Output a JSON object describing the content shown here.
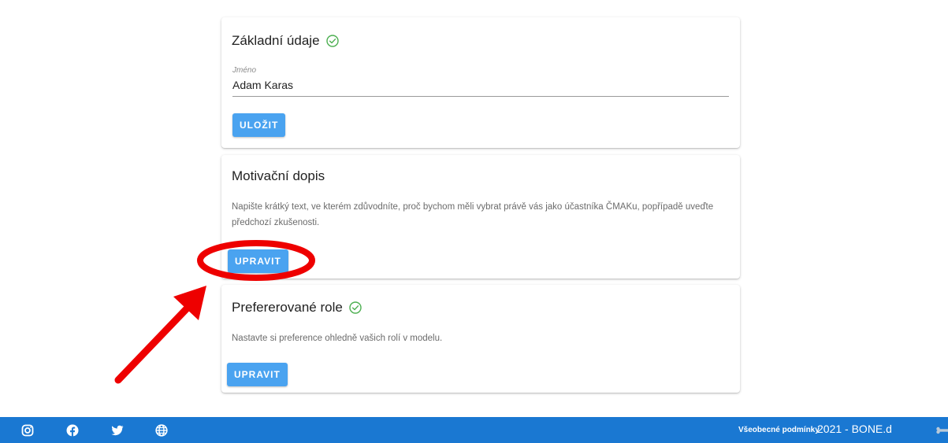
{
  "sections": {
    "basic_info": {
      "title": "Základní údaje",
      "field_label": "Jméno",
      "field_value": "Adam Karas",
      "save_label": "ULOŽIT"
    },
    "motivation": {
      "title": "Motivační dopis",
      "description": "Napište krátký text, ve kterém zdůvodníte, proč bychom měli vybrat právě vás jako účastníka ČMAKu, popřípadě uveďte předchozí zkušenosti.",
      "edit_label": "UPRAVIT"
    },
    "preferred_roles": {
      "title": "Prefererované role",
      "description": "Nastavte si preference ohledně vašich rolí v modelu.",
      "edit_label": "UPRAVIT"
    }
  },
  "footer": {
    "social_icons": [
      "instagram-icon",
      "facebook-icon",
      "twitter-icon",
      "globe-icon"
    ],
    "terms_label": "Všeobecné podmínky",
    "copyright": "2021 - BONE.d"
  },
  "colors": {
    "primary_button": "#4aa3f0",
    "footer_bg": "#1a78d2",
    "check_green": "#4caf50",
    "annotation_red": "#ee0000"
  }
}
